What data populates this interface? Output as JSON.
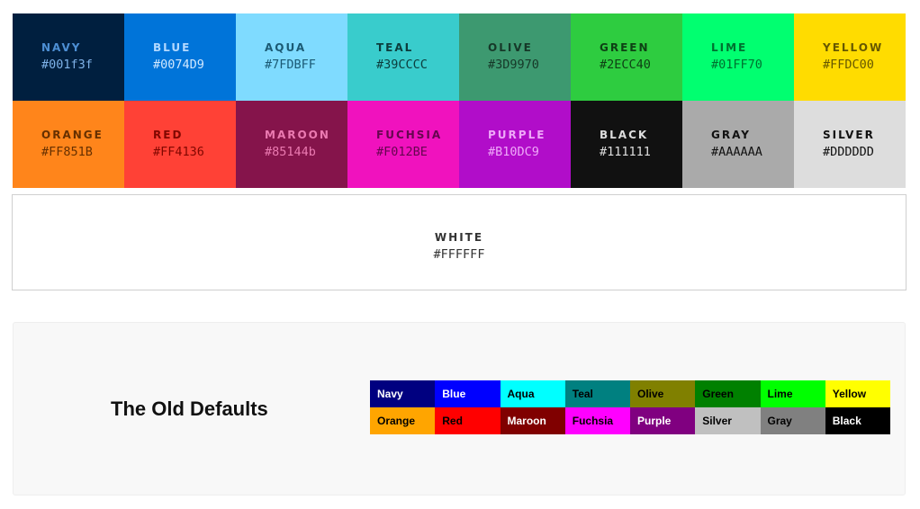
{
  "swatches": [
    {
      "name": "NAVY",
      "hex": "#001f3f",
      "bg": "#001f3f",
      "name_color": "#4d8fd4",
      "hex_color": "#7fb2e8"
    },
    {
      "name": "BLUE",
      "hex": "#0074D9",
      "bg": "#0074d9",
      "name_color": "#b3d9ff",
      "hex_color": "#d1e8ff"
    },
    {
      "name": "AQUA",
      "hex": "#7FDBFF",
      "bg": "#7fdbff",
      "name_color": "#1b5a74",
      "hex_color": "#1b5a74"
    },
    {
      "name": "TEAL",
      "hex": "#39CCCC",
      "bg": "#39cccc",
      "name_color": "#0c3c3c",
      "hex_color": "#0c3c3c"
    },
    {
      "name": "OLIVE",
      "hex": "#3D9970",
      "bg": "#3d9970",
      "name_color": "#163828",
      "hex_color": "#163828"
    },
    {
      "name": "GREEN",
      "hex": "#2ECC40",
      "bg": "#2ecc40",
      "name_color": "#0e4014",
      "hex_color": "#0e4014"
    },
    {
      "name": "LIME",
      "hex": "#01FF70",
      "bg": "#01ff70",
      "name_color": "#00702f",
      "hex_color": "#00702f"
    },
    {
      "name": "YELLOW",
      "hex": "#FFDC00",
      "bg": "#ffdc00",
      "name_color": "#665800",
      "hex_color": "#665800"
    },
    {
      "name": "ORANGE",
      "hex": "#FF851B",
      "bg": "#ff851b",
      "name_color": "#663000",
      "hex_color": "#663000"
    },
    {
      "name": "RED",
      "hex": "#FF4136",
      "bg": "#ff4136",
      "name_color": "#800700",
      "hex_color": "#800700"
    },
    {
      "name": "MAROON",
      "hex": "#85144b",
      "bg": "#85144b",
      "name_color": "#eb7ab1",
      "hex_color": "#eb7ab1"
    },
    {
      "name": "FUCHSIA",
      "hex": "#F012BE",
      "bg": "#f012be",
      "name_color": "#65064f",
      "hex_color": "#65064f"
    },
    {
      "name": "PURPLE",
      "hex": "#B10DC9",
      "bg": "#b10dc9",
      "name_color": "#efa9f9",
      "hex_color": "#efa9f9"
    },
    {
      "name": "BLACK",
      "hex": "#111111",
      "bg": "#111111",
      "name_color": "#dddddd",
      "hex_color": "#dddddd"
    },
    {
      "name": "GRAY",
      "hex": "#AAAAAA",
      "bg": "#aaaaaa",
      "name_color": "#111111",
      "hex_color": "#111111"
    },
    {
      "name": "SILVER",
      "hex": "#DDDDDD",
      "bg": "#dddddd",
      "name_color": "#111111",
      "hex_color": "#111111"
    }
  ],
  "white": {
    "name": "WHITE",
    "hex": "#FFFFFF"
  },
  "old_defaults": {
    "title": "The Old Defaults",
    "cells": [
      {
        "label": "Navy",
        "bg": "#000080",
        "fg": "#ffffff"
      },
      {
        "label": "Blue",
        "bg": "#0000ff",
        "fg": "#ffffff"
      },
      {
        "label": "Aqua",
        "bg": "#00ffff",
        "fg": "#000000"
      },
      {
        "label": "Teal",
        "bg": "#008080",
        "fg": "#000000"
      },
      {
        "label": "Olive",
        "bg": "#808000",
        "fg": "#000000"
      },
      {
        "label": "Green",
        "bg": "#008000",
        "fg": "#000000"
      },
      {
        "label": "Lime",
        "bg": "#00ff00",
        "fg": "#000000"
      },
      {
        "label": "Yellow",
        "bg": "#ffff00",
        "fg": "#000000"
      },
      {
        "label": "Orange",
        "bg": "#ffa500",
        "fg": "#000000"
      },
      {
        "label": "Red",
        "bg": "#ff0000",
        "fg": "#000000"
      },
      {
        "label": "Maroon",
        "bg": "#800000",
        "fg": "#ffffff"
      },
      {
        "label": "Fuchsia",
        "bg": "#ff00ff",
        "fg": "#000000"
      },
      {
        "label": "Purple",
        "bg": "#800080",
        "fg": "#ffffff"
      },
      {
        "label": "Silver",
        "bg": "#c0c0c0",
        "fg": "#000000"
      },
      {
        "label": "Gray",
        "bg": "#808080",
        "fg": "#000000"
      },
      {
        "label": "Black",
        "bg": "#000000",
        "fg": "#ffffff"
      }
    ]
  }
}
